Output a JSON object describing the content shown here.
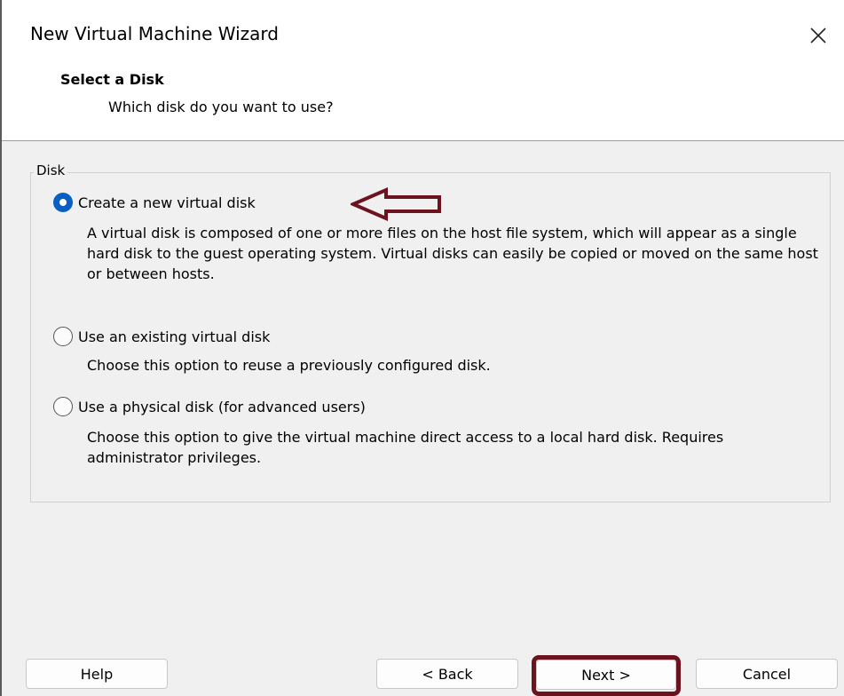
{
  "window": {
    "title": "New Virtual Machine Wizard"
  },
  "header": {
    "title": "Select a Disk",
    "subtitle": "Which disk do you want to use?"
  },
  "disk_group": {
    "legend": "Disk",
    "options": [
      {
        "label": "Create a new virtual disk",
        "checked": true,
        "description": "A virtual disk is composed of one or more files on the host file system, which will appear as a single hard disk to the guest operating system. Virtual disks can easily be copied or moved on the same host or between hosts."
      },
      {
        "label": "Use an existing virtual disk",
        "checked": false,
        "description": "Choose this option to reuse a previously configured disk."
      },
      {
        "label": "Use a physical disk (for advanced users)",
        "checked": false,
        "description": "Choose this option to give the virtual machine direct access to a local hard disk. Requires administrator privileges."
      }
    ]
  },
  "buttons": {
    "help": "Help",
    "back": "< Back",
    "next": "Next >",
    "cancel": "Cancel"
  },
  "icons": {
    "close": "close-icon",
    "annotation": "arrow-left-annotation-icon"
  },
  "colors": {
    "radio_selected": "#0a5fc2",
    "annotation": "#6b1420"
  }
}
